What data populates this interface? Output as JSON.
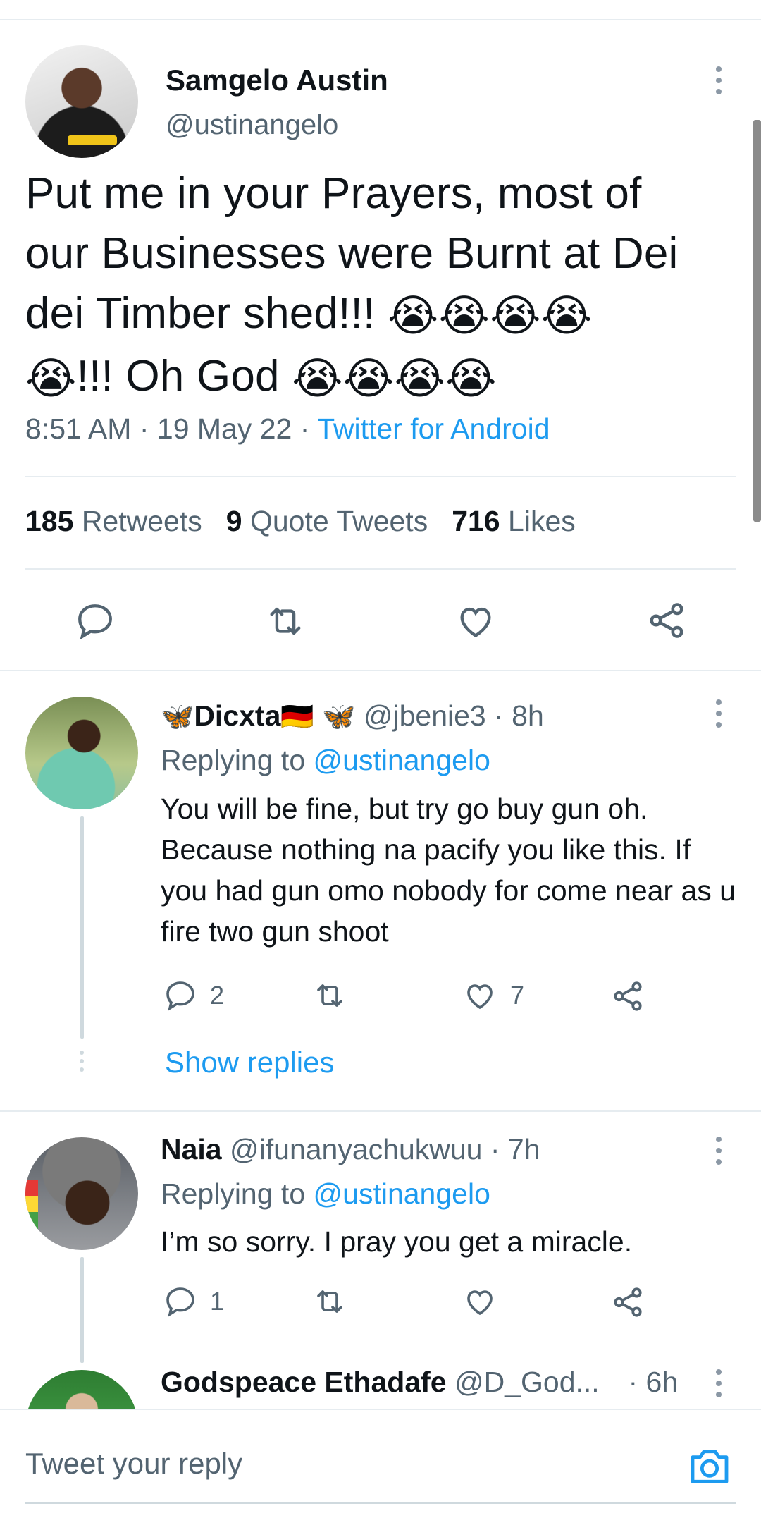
{
  "tweet": {
    "author_name": "Samgelo Austin",
    "author_handle": "@ustinangelo",
    "text_line1": "Put me in your Prayers, most of",
    "text_line2": "our Businesses were Burnt at Dei",
    "text_line3": "dei Timber shed!!!",
    "text_line4_mid": "!!! Oh God",
    "crying_emoji": "😭",
    "time": "8:51 AM",
    "date": "19 May 22",
    "source": "Twitter for Android",
    "separator": "·"
  },
  "stats": {
    "retweets_count": "185",
    "retweets_label": "Retweets",
    "quotes_count": "9",
    "quotes_label": "Quote Tweets",
    "likes_count": "716",
    "likes_label": "Likes"
  },
  "replies": [
    {
      "name": "Dicxta",
      "name_prefix_emoji": "🦋",
      "name_suffix_emoji": "🇩🇪",
      "handle_prefix_emoji": "🦋",
      "handle": "@jbenie3",
      "time": "· 8h",
      "replying_label": "Replying to",
      "mention": "@ustinangelo",
      "text": "You will be fine, but try go buy gun oh. Because nothing na pacify you like this. If you had gun omo nobody for come near as u fire two gun shoot",
      "reply_count": "2",
      "like_count": "7",
      "show_replies": "Show replies"
    },
    {
      "name": "Naia",
      "handle": "@ifunanyachukwuu",
      "time": "· 7h",
      "replying_label": "Replying to",
      "mention": "@ustinangelo",
      "text": "I’m so sorry. I pray you get a miracle.",
      "reply_count": "1",
      "like_count": ""
    },
    {
      "name": "Godspeace Ethadafe",
      "handle": "@D_God...",
      "time": "· 6h"
    }
  ],
  "composer": {
    "placeholder": "Tweet your reply",
    "camera_icon": "camera-icon"
  },
  "colors": {
    "accent": "#1d9bf0",
    "text": "#0f1419",
    "secondary": "#536471",
    "divider": "#e6ecf0"
  }
}
